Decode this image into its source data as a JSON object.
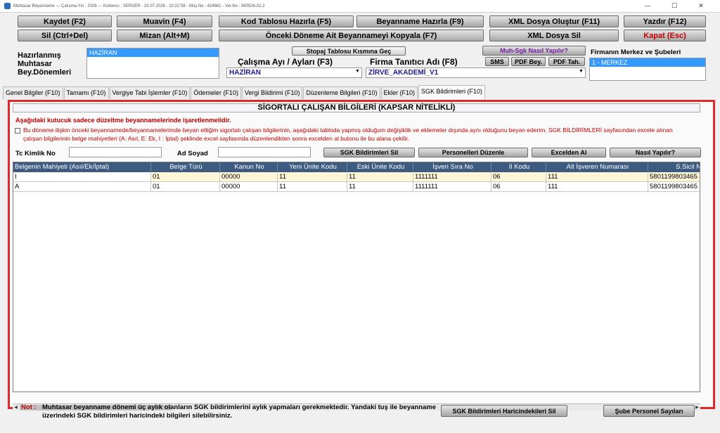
{
  "window": {
    "title": "Muhtasar Beyanname  ---  Çalışma Yılı : 2026  ---  Kullanıcı : SERVER - 23.07.2026 - 10:22:58 - Müş.No : 424681 - Ver.No : 060526-02.2",
    "min": "—",
    "max": "☐",
    "close": "✕"
  },
  "toolbar": {
    "kaydet": "Kaydet (F2)",
    "muavin": "Muavin (F4)",
    "kod_tablosu": "Kod Tablosu Hazırla (F5)",
    "beyanname_hazirla": "Beyanname Hazırla (F9)",
    "xml_olustur": "XML Dosya Oluştur (F11)",
    "yazdir": "Yazdır (F12)",
    "sil": "Sil (Ctrl+Del)",
    "mizan": "Mizan (Alt+M)",
    "onceki_kopyala": "Önceki Döneme Ait Beyannameyi Kopyala (F7)",
    "xml_sil": "XML Dosya Sil",
    "kapat": "Kapat (Esc)"
  },
  "header": {
    "hazirlanmis_label": "Hazırlanmış\nMuhtasar\nBey.Dönemleri",
    "hazirlanmis_selected": "HAZİRAN",
    "stopaj_button": "Stopaj Tablosu Kısmına Geç",
    "calisma_ayi_label": "Çalışma Ayı / Ayları (F3)",
    "calisma_ayi_value": "HAZİRAN",
    "firma_label": "Firma Tanıtıcı Adı (F8)",
    "firma_value": "ZİRVE_AKADEMİ_V1",
    "muh_sgk_button": "Muh-Sgk Nasıl Yapılır?",
    "sms_button": "SMS",
    "pdf_bey_button": "PDF Bey.",
    "pdf_tah_button": "PDF Tah.",
    "merkez_label": "Firmanın Merkez ve Şubeleri",
    "merkez_selected": "1 - MERKEZ"
  },
  "tabs": [
    {
      "label": "Genel Bilgiler (F10)",
      "active": false
    },
    {
      "label": "Tamamı (F10)",
      "active": false
    },
    {
      "label": "Vergiye Tabi İşlemler (F10)",
      "active": false
    },
    {
      "label": "Ödemeler (F10)",
      "active": false
    },
    {
      "label": "Vergi Bildirimi (F10)",
      "active": false
    },
    {
      "label": "Düzenleme Bilgileri (F10)",
      "active": false
    },
    {
      "label": "Ekler (F10)",
      "active": false
    },
    {
      "label": "SGK Bildirimleri (F10)",
      "active": true
    }
  ],
  "panel": {
    "title": "SİGORTALI ÇALIŞAN BİLGİLERİ (KAPSAR NİTELİKLİ)",
    "warn1": "Aşağıdaki kutucuk sadece düzeltme beyannamelerinde işaretlenmelidir.",
    "warn2": "Bu döneme ilişkin önceki beyannamede/beyannamelerimde beyan ettiğim sigortalı çalışan bilgilerinin, aşağıdaki tabloda yapmış olduğum değişiklik ve eklemeler dışında aynı olduğunu beyan ederim. SGK BİLDİRİMLERİ sayfasından excele alınan çalışan bilgilerinin belge mahiyetleri (A: Asıl, E: Ek, I : İptal) şeklinde excel sayfasında düzenlendikten sonra excelden al butonu ile bu alana çekilir.",
    "tc_label": "Tc Kimlik No",
    "tc_value": "",
    "adsoyad_label": "Ad Soyad",
    "adsoyad_value": "",
    "sgk_sil_button": "SGK Bildirimleri Sil",
    "personelleri_button": "Personelleri Düzenle",
    "excelden_button": "Excelden Al",
    "nasil_button": "Nasıl Yapılır?"
  },
  "grid": {
    "columns": [
      "Belgenin Mahiyeti (Asıl/Ek/İptal)",
      "Belge Türü",
      "Kanun No",
      "Yeni Ünite Kodu",
      "Eski Ünite Kodu",
      "İşveri Sıra No",
      "İl Kodu",
      "Alt İşveren Numarası",
      "S.Sicil N"
    ],
    "rows": [
      [
        "I",
        "01",
        "00000",
        "11",
        "11",
        "1111111",
        "06",
        "111",
        "5801199803465"
      ],
      [
        "A",
        "01",
        "00000",
        "11",
        "11",
        "1111111",
        "06",
        "111",
        "5801199803465"
      ]
    ]
  },
  "footer": {
    "note_label": "Not :",
    "note_text": "Muhtasar beyanname dönemi üç aylık olanların SGK bildirimlerini aylık yapmaları gerekmektedir. Yandaki tuş ile beyanname üzerindeki SGK bildirimleri haricindeki bilgileri silebilirsiniz.",
    "haricindekileri_sil": "SGK Bildirimleri Haricindekileri Sil",
    "sube_personel": "Şube Personel Sayıları"
  },
  "colors": {
    "panel_border": "#e0282b",
    "grid_header": "#3d5a80",
    "selection": "#3399ff",
    "warning_text": "#c00000"
  }
}
